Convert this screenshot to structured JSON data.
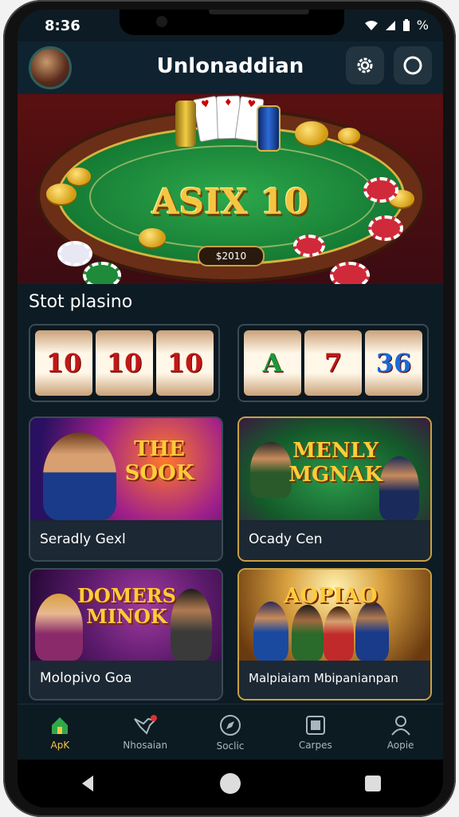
{
  "status_bar": {
    "time": "8:36",
    "signal_icon": "wifi-icon",
    "battery_text": "%"
  },
  "header": {
    "title": "Unlonaddian",
    "settings_icon": "gear-icon",
    "profile_icon": "circle-icon"
  },
  "banner": {
    "title": "ASIX 10",
    "code": "$2010"
  },
  "section": {
    "title": "Stot plasino"
  },
  "slots": [
    {
      "reels": [
        "10",
        "10",
        "10"
      ]
    },
    {
      "reels": [
        "A",
        "7",
        "36"
      ]
    }
  ],
  "games": [
    {
      "label": "Seradly Gexl",
      "art_title": "THE SOOK"
    },
    {
      "label": "Ocady Cen",
      "art_title": "MENLY MGNAK"
    },
    {
      "label": "Molopivo Goa",
      "art_title": "DOMERS MINOK"
    },
    {
      "label": "Malpiaiam Mbipanianpan",
      "art_title": "AOPIAO"
    }
  ],
  "bottom_nav": [
    {
      "label": "ApK",
      "icon": "home-icon",
      "active": true
    },
    {
      "label": "Nhosaian",
      "icon": "bird-icon",
      "active": false
    },
    {
      "label": "Soclic",
      "icon": "compass-icon",
      "active": false
    },
    {
      "label": "Carpes",
      "icon": "square-icon",
      "active": false
    },
    {
      "label": "Aopie",
      "icon": "user-icon",
      "active": false
    }
  ],
  "colors": {
    "background": "#0d1b24",
    "accent": "#f5c542",
    "felt": "#1f8f3c"
  }
}
